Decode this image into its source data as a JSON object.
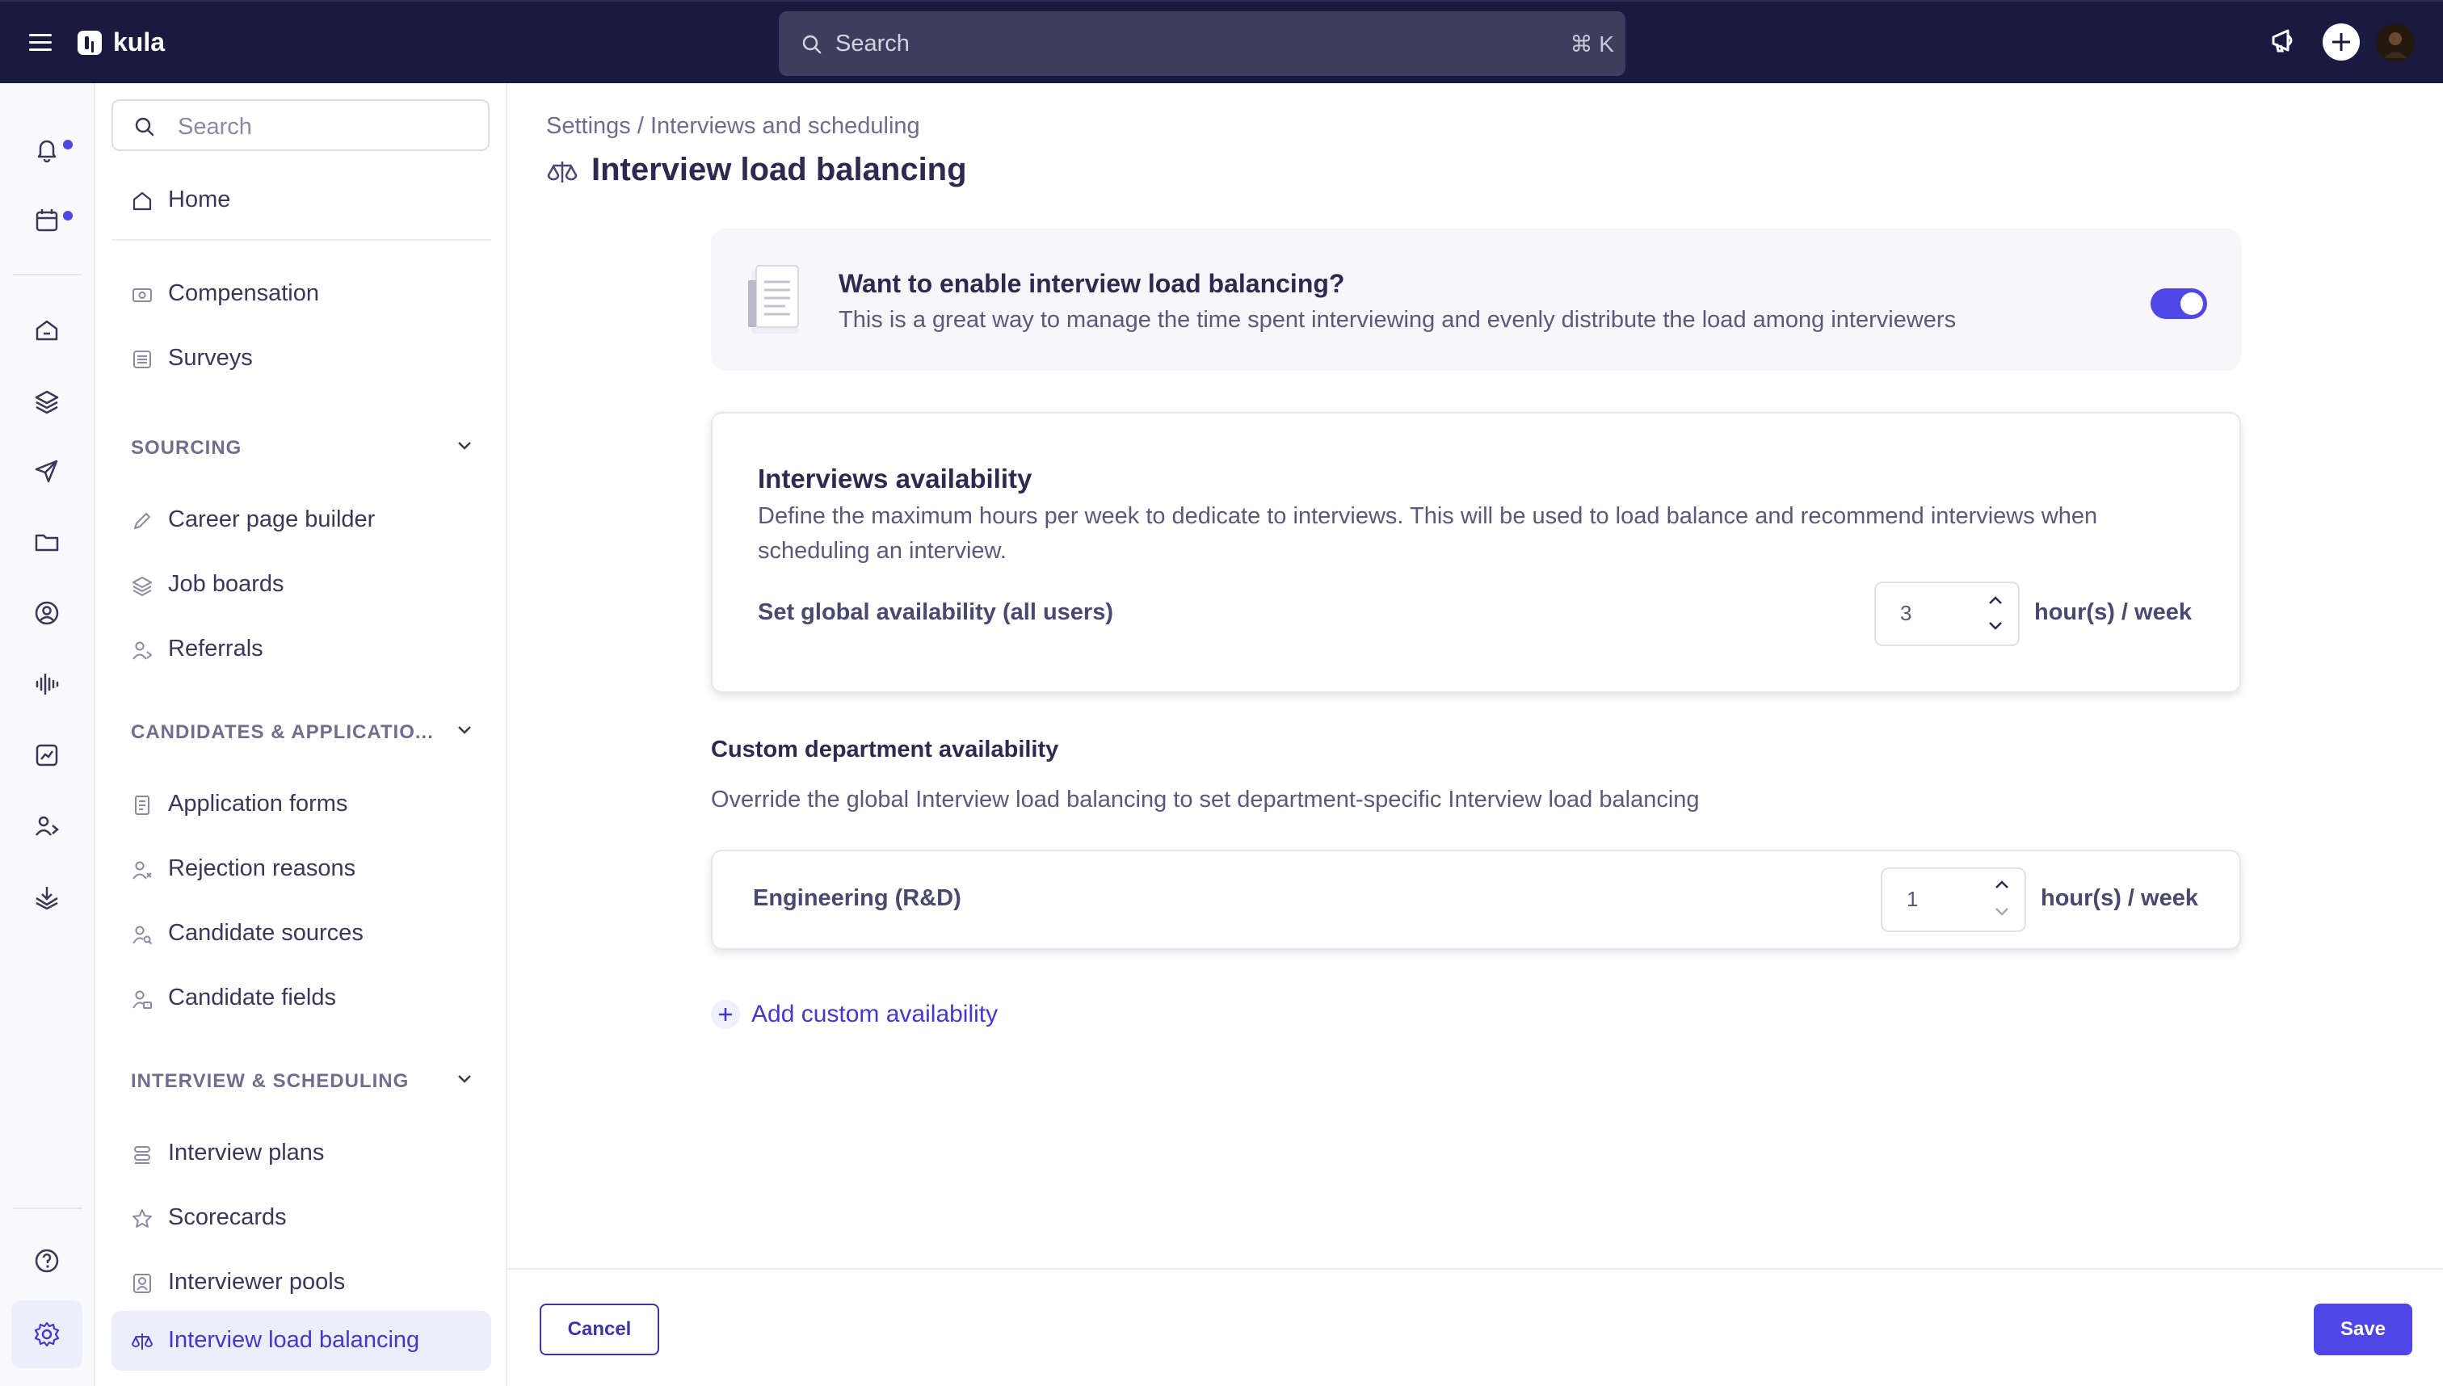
{
  "app": {
    "name": "kula"
  },
  "topbar": {
    "search_placeholder": "Search",
    "search_shortcut": "⌘ K"
  },
  "rail": {
    "icons": [
      "bell-icon",
      "calendar-icon",
      "home-icon",
      "layers-icon",
      "send-icon",
      "folder-icon",
      "user-circle-icon",
      "waveform-icon",
      "analytics-icon",
      "users-icon",
      "inbox-download-icon",
      "help-icon",
      "gear-icon"
    ],
    "notification_color": "#4f46e5"
  },
  "sidebar": {
    "search_placeholder": "Search",
    "home": "Home",
    "general": [
      "Compensation",
      "Surveys"
    ],
    "sections": [
      {
        "title": "SOURCING",
        "items": [
          "Career page builder",
          "Job boards",
          "Referrals"
        ]
      },
      {
        "title": "CANDIDATES & APPLICATIO...",
        "items": [
          "Application forms",
          "Rejection reasons",
          "Candidate sources",
          "Candidate fields"
        ]
      },
      {
        "title": "INTERVIEW & SCHEDULING",
        "items": [
          "Interview plans",
          "Scorecards",
          "Interviewer pools",
          "Interview load balancing"
        ]
      }
    ],
    "active_item": "Interview load balancing"
  },
  "main": {
    "breadcrumb": "Settings / Interviews and scheduling",
    "title": "Interview load balancing",
    "enable": {
      "title": "Want to enable interview load balancing?",
      "description": "This is a great way to manage the time spent interviewing and evenly distribute the load among interviewers",
      "enabled": true
    },
    "availability": {
      "title": "Interviews availability",
      "description": "Define the maximum hours per week to dedicate to interviews. This will be used to load balance and recommend interviews when scheduling an interview.",
      "global_label": "Set global availability (all users)",
      "global_value": "3",
      "unit": "hour(s) / week"
    },
    "custom": {
      "title": "Custom department availability",
      "description": "Override the global Interview load balancing to set department-specific Interview load balancing",
      "departments": [
        {
          "name": "Engineering (R&D)",
          "value": "1",
          "unit": "hour(s) / week"
        }
      ],
      "add_label": "Add custom availability"
    }
  },
  "footer": {
    "cancel": "Cancel",
    "save": "Save"
  },
  "colors": {
    "accent": "#4f46e5",
    "topbar": "#1a1a40"
  }
}
